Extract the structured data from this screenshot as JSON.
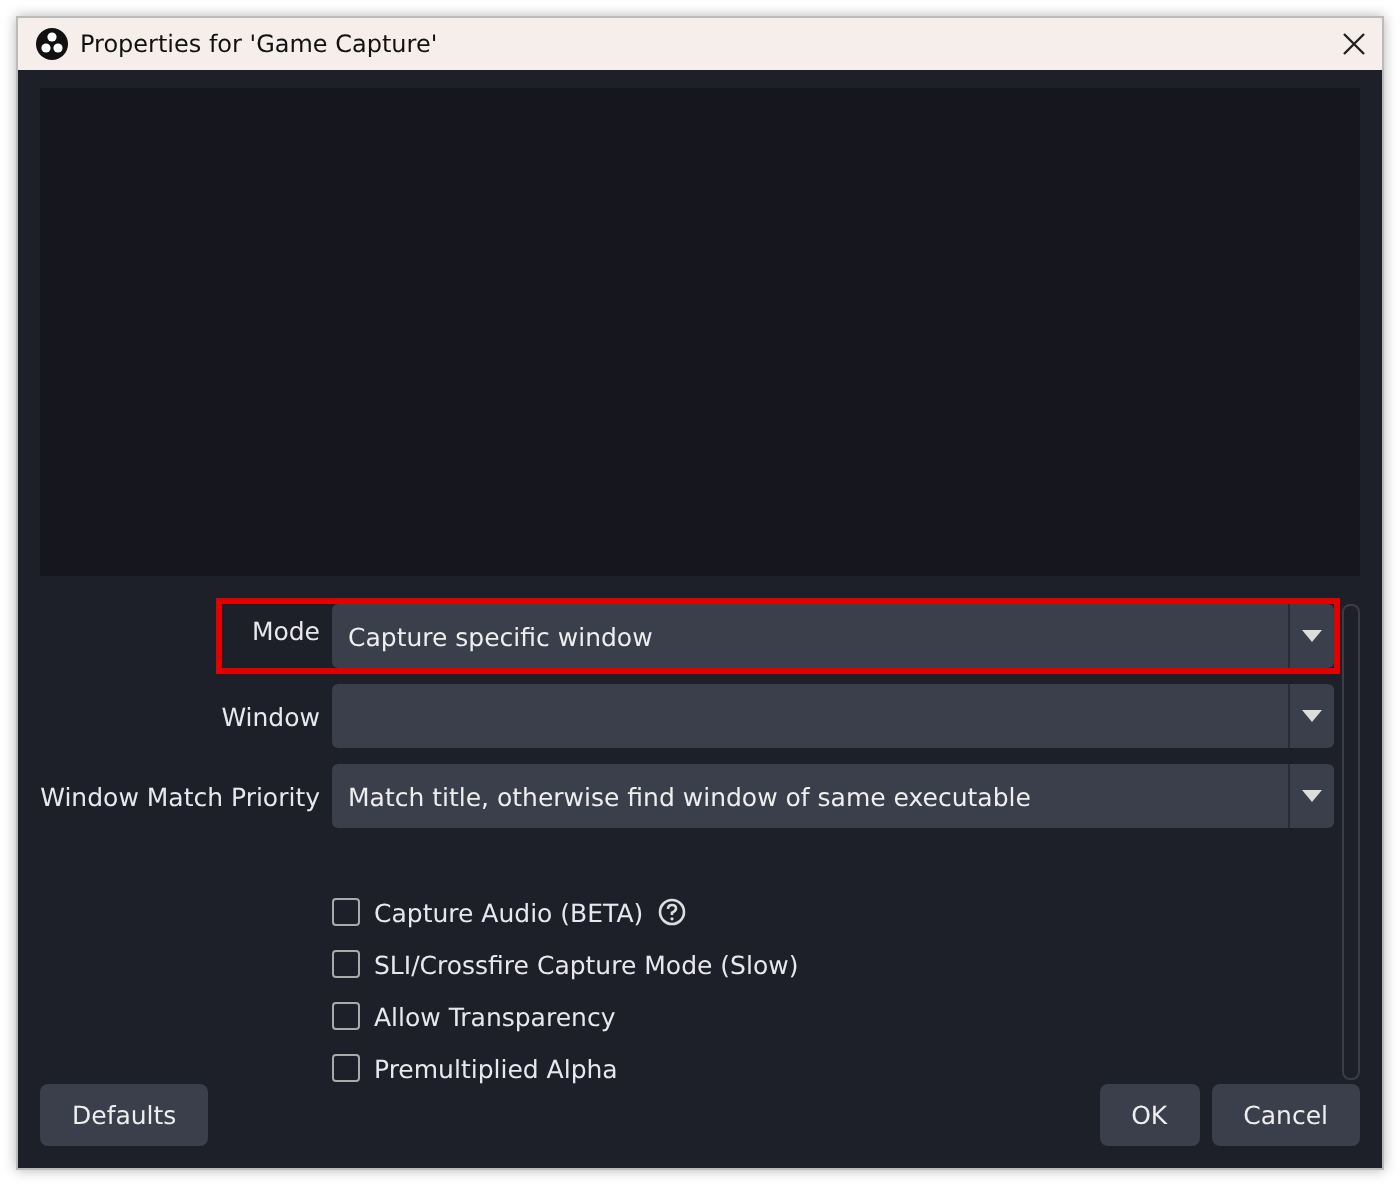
{
  "window": {
    "title": "Properties for 'Game Capture'"
  },
  "fields": [
    {
      "label": "Mode",
      "value": "Capture specific window",
      "highlighted": true
    },
    {
      "label": "Window",
      "highlighted": false
    },
    {
      "label": "Window Match Priority",
      "value": "Match title, otherwise find window of same executable",
      "highlighted": false
    }
  ],
  "checkboxes": [
    {
      "label": "Capture Audio (BETA)",
      "checked": false,
      "help": true
    },
    {
      "label": "SLI/Crossfire Capture Mode (Slow)",
      "checked": false,
      "help": false
    },
    {
      "label": "Allow Transparency",
      "checked": false,
      "help": false
    },
    {
      "label": "Premultiplied Alpha",
      "checked": false,
      "help": false
    }
  ],
  "buttons": {
    "left": [
      "Defaults"
    ],
    "right": [
      "OK",
      "Cancel"
    ]
  }
}
